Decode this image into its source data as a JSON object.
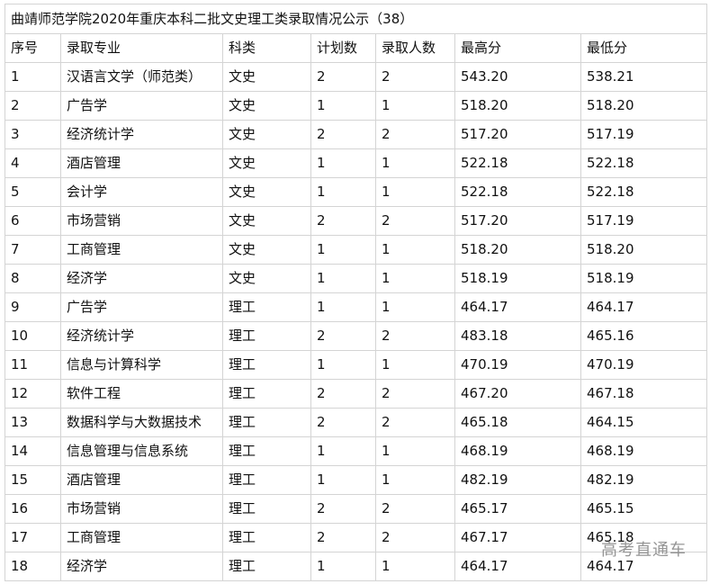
{
  "title": "曲靖师范学院2020年重庆本科二批文史理工类录取情况公示（38）",
  "headers": [
    "序号",
    "录取专业",
    "科类",
    "计划数",
    "录取人数",
    "最高分",
    "最低分"
  ],
  "rows": [
    [
      "1",
      "汉语言文学（师范类）",
      "文史",
      "2",
      "2",
      "543.20",
      "538.21"
    ],
    [
      "2",
      "广告学",
      "文史",
      "1",
      "1",
      "518.20",
      "518.20"
    ],
    [
      "3",
      "经济统计学",
      "文史",
      "2",
      "2",
      "517.20",
      "517.19"
    ],
    [
      "4",
      "酒店管理",
      "文史",
      "1",
      "1",
      "522.18",
      "522.18"
    ],
    [
      "5",
      "会计学",
      "文史",
      "1",
      "1",
      "522.18",
      "522.18"
    ],
    [
      "6",
      "市场营销",
      "文史",
      "2",
      "2",
      "517.20",
      "517.19"
    ],
    [
      "7",
      "工商管理",
      "文史",
      "1",
      "1",
      "518.20",
      "518.20"
    ],
    [
      "8",
      "经济学",
      "文史",
      "1",
      "1",
      "518.19",
      "518.19"
    ],
    [
      "9",
      "广告学",
      "理工",
      "1",
      "1",
      "464.17",
      "464.17"
    ],
    [
      "10",
      "经济统计学",
      "理工",
      "2",
      "2",
      "483.18",
      "465.16"
    ],
    [
      "11",
      "信息与计算科学",
      "理工",
      "1",
      "1",
      "470.19",
      "470.19"
    ],
    [
      "12",
      "软件工程",
      "理工",
      "2",
      "2",
      "467.20",
      "467.18"
    ],
    [
      "13",
      "数据科学与大数据技术",
      "理工",
      "2",
      "2",
      "465.18",
      "464.15"
    ],
    [
      "14",
      "信息管理与信息系统",
      "理工",
      "1",
      "1",
      "468.19",
      "468.19"
    ],
    [
      "15",
      "酒店管理",
      "理工",
      "1",
      "1",
      "482.19",
      "482.19"
    ],
    [
      "16",
      "市场营销",
      "理工",
      "2",
      "2",
      "465.17",
      "465.15"
    ],
    [
      "17",
      "工商管理",
      "理工",
      "2",
      "2",
      "467.17",
      "465.18"
    ],
    [
      "18",
      "经济学",
      "理工",
      "1",
      "1",
      "464.17",
      "464.17"
    ]
  ],
  "watermark": "高考直通车"
}
